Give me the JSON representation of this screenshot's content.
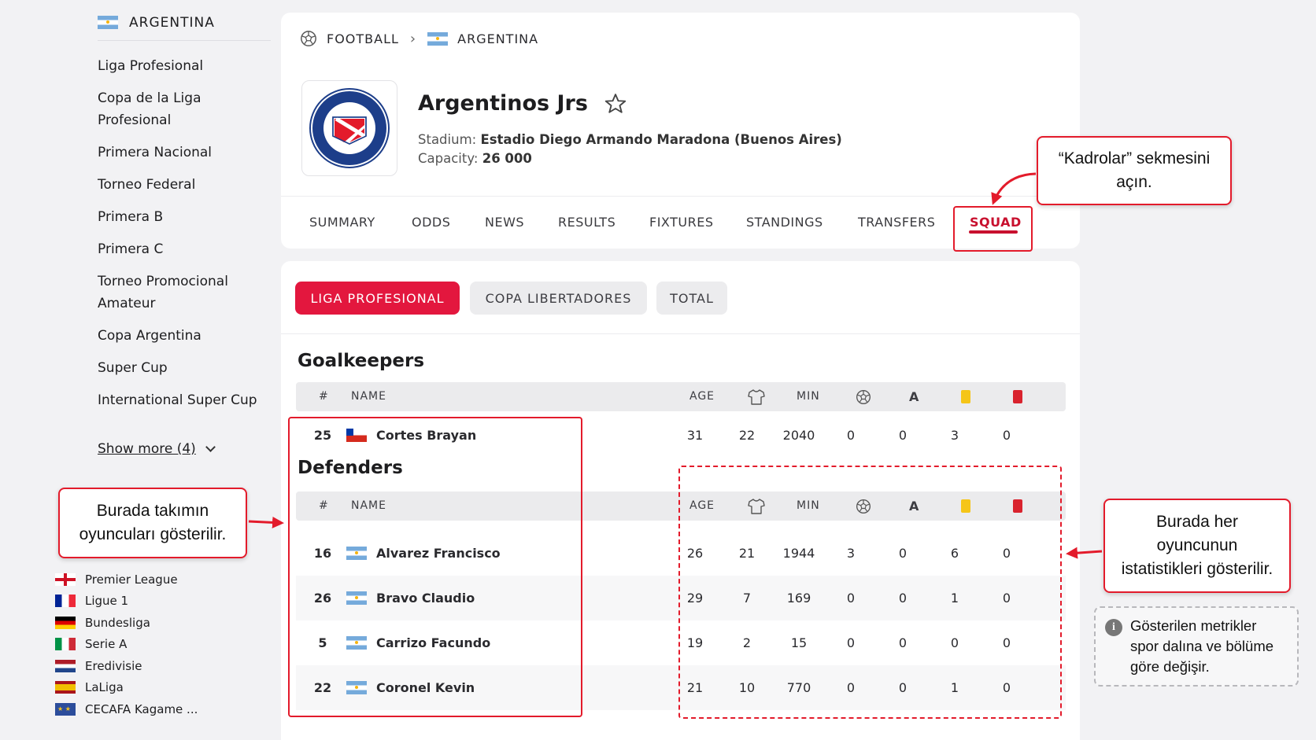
{
  "sidebar": {
    "country": "ARGENTINA",
    "leagues": [
      "Liga Profesional",
      "Copa de la Liga Profesional",
      "Primera Nacional",
      "Torneo Federal",
      "Primera B",
      "Primera C",
      "Torneo Promocional Amateur",
      "Copa Argentina",
      "Super Cup",
      "International Super Cup"
    ],
    "show_more": "Show more (4)",
    "top_leagues": [
      {
        "name": "Premier League",
        "flag": "england-flag"
      },
      {
        "name": "Ligue 1",
        "flag": "france-flag"
      },
      {
        "name": "Bundesliga",
        "flag": "germany-flag"
      },
      {
        "name": "Serie A",
        "flag": "italy-flag"
      },
      {
        "name": "Eredivisie",
        "flag": "netherlands-flag"
      },
      {
        "name": "LaLiga",
        "flag": "spain-flag"
      },
      {
        "name": "CECAFA Kagame ...",
        "flag": "africa-flag"
      }
    ]
  },
  "breadcrumb": {
    "sport": "FOOTBALL",
    "country": "ARGENTINA"
  },
  "team": {
    "name": "Argentinos Jrs",
    "stadium_label": "Stadium:",
    "stadium": "Estadio Diego Armando Maradona (Buenos Aires)",
    "capacity_label": "Capacity:",
    "capacity": "26 000"
  },
  "tabs": [
    "SUMMARY",
    "ODDS",
    "NEWS",
    "RESULTS",
    "FIXTURES",
    "STANDINGS",
    "TRANSFERS",
    "SQUAD"
  ],
  "active_tab": "SQUAD",
  "competitions": [
    "LIGA PROFESIONAL",
    "COPA LIBERTADORES",
    "TOTAL"
  ],
  "table_headers": {
    "num": "#",
    "name": "NAME",
    "age": "AGE",
    "min": "MIN"
  },
  "sections": [
    {
      "title": "Goalkeepers",
      "players": [
        {
          "num": "25",
          "name": "Cortes Brayan",
          "flag": "chile-flag",
          "age": "31",
          "apps": "22",
          "min": "2040",
          "goals": "0",
          "assists": "0",
          "yellow": "3",
          "red": "0"
        }
      ]
    },
    {
      "title": "Defenders",
      "players": [
        {
          "num": "16",
          "name": "Alvarez Francisco",
          "flag": "argentina-flag",
          "age": "26",
          "apps": "21",
          "min": "1944",
          "goals": "3",
          "assists": "0",
          "yellow": "6",
          "red": "0"
        },
        {
          "num": "26",
          "name": "Bravo Claudio",
          "flag": "argentina-flag",
          "age": "29",
          "apps": "7",
          "min": "169",
          "goals": "0",
          "assists": "0",
          "yellow": "1",
          "red": "0"
        },
        {
          "num": "5",
          "name": "Carrizo Facundo",
          "flag": "argentina-flag",
          "age": "19",
          "apps": "2",
          "min": "15",
          "goals": "0",
          "assists": "0",
          "yellow": "0",
          "red": "0"
        },
        {
          "num": "22",
          "name": "Coronel Kevin",
          "flag": "argentina-flag",
          "age": "21",
          "apps": "10",
          "min": "770",
          "goals": "0",
          "assists": "0",
          "yellow": "1",
          "red": "0"
        }
      ]
    }
  ],
  "annotations": {
    "squad_tab": "“Kadrolar” sekmesini açın.",
    "players": "Burada takımın oyuncuları gösterilir.",
    "stats": "Burada her oyuncunun istatistikleri gösterilir.",
    "info": "Gösterilen metrikler spor dalına ve bölüme göre değişir."
  },
  "colors": {
    "accent": "#e3173e",
    "annotation": "#e31b2b",
    "yellow_card": "#f5c518",
    "red_card": "#d9232e"
  }
}
